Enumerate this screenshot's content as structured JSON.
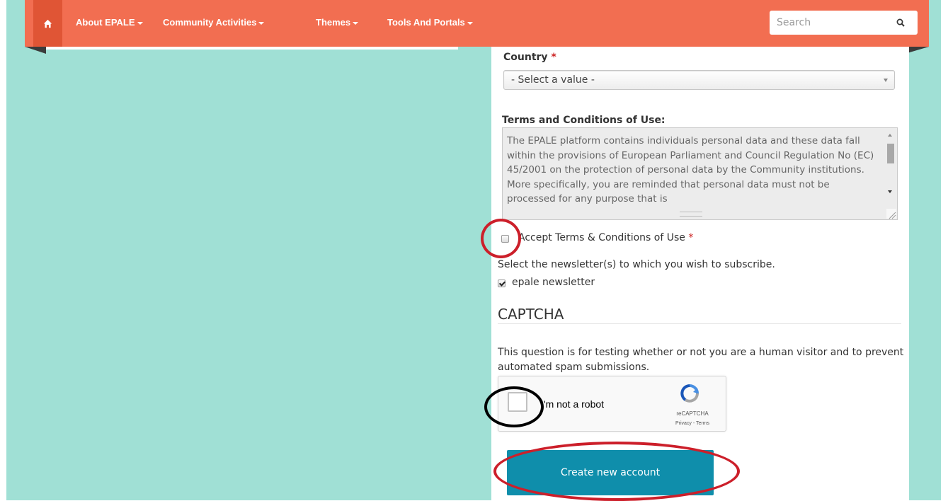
{
  "navbar": {
    "home_icon": "home-icon",
    "items": [
      {
        "label": "About EPALE"
      },
      {
        "label": "Community Activities"
      },
      {
        "label": "Themes"
      },
      {
        "label": "Tools And Portals"
      }
    ],
    "search": {
      "placeholder": "Search",
      "icon": "search-icon"
    }
  },
  "form": {
    "country": {
      "label": "Country",
      "required_mark": "*",
      "value": "- Select a value -"
    },
    "terms": {
      "label": "Terms and Conditions of Use:",
      "text": "The EPALE platform contains individuals personal data and these data fall within the provisions of European Parliament and Council Regulation No (EC) 45/2001 on the protection of personal data by the Community institutions. More specifically, you are reminded that personal data must not be processed for any purpose that is"
    },
    "accept": {
      "label": "Accept Terms & Conditions of Use",
      "required_mark": "*",
      "checked": false
    },
    "newsletter": {
      "prompt": "Select the newsletter(s) to which you wish to subscribe.",
      "option_label": "epale newsletter",
      "checked": true
    },
    "captcha": {
      "title": "CAPTCHA",
      "description": "This question is for testing whether or not you are a human visitor and to prevent automated spam submissions.",
      "checkbox_label": "I'm not a robot",
      "brand": "reCAPTCHA",
      "links": "Privacy - Terms"
    },
    "submit_label": "Create new account"
  },
  "colors": {
    "navbar": "#f26e51",
    "navbar_home": "#e05535",
    "page_background": "#a0e0d5",
    "button": "#0f8eab",
    "annotation_red": "#cc1f2a",
    "annotation_black": "#000000"
  }
}
